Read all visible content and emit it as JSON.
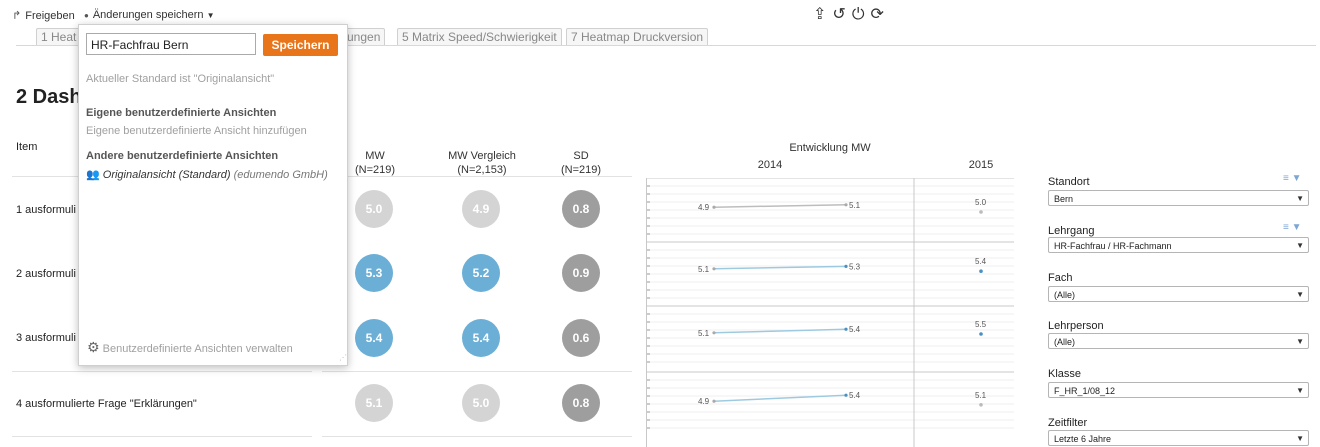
{
  "toolbar": {
    "share_label": "Freigeben",
    "save_changes_label": "Änderungen speichern",
    "icons": [
      "export-icon",
      "undo-icon",
      "power-icon",
      "refresh-icon"
    ]
  },
  "tabs": [
    {
      "label": "1 Heat"
    },
    {
      "label": "kungen"
    },
    {
      "label": "5 Matrix Speed/Schwierigkeit"
    },
    {
      "label": "7 Heatmap Druckversion"
    }
  ],
  "page_title": "2 Dash",
  "table": {
    "item_header": "Item",
    "columns": [
      {
        "title": "MW",
        "sub": "(N=219)"
      },
      {
        "title": "MW Vergleich",
        "sub": "(N=2,153)"
      },
      {
        "title": "SD",
        "sub": "(N=219)"
      }
    ],
    "rows": [
      {
        "label": "1 ausformuli",
        "mw": "5.0",
        "mw_cmp": "4.9",
        "sd": "0.8"
      },
      {
        "label": "2 ausformuli",
        "mw": "5.3",
        "mw_cmp": "5.2",
        "sd": "0.9"
      },
      {
        "label": "3 ausformuli",
        "mw": "5.4",
        "mw_cmp": "5.4",
        "sd": "0.6"
      },
      {
        "label": "4 ausformulierte Frage \"Erklärungen\"",
        "mw": "5.1",
        "mw_cmp": "5.0",
        "sd": "0.8"
      }
    ]
  },
  "chart_data": {
    "type": "line",
    "title": "Entwicklung MW",
    "years": [
      "2014",
      "2015"
    ],
    "rows": [
      {
        "y2014": [
          4.9,
          5.1
        ],
        "y2015": 5.0
      },
      {
        "y2014": [
          5.1,
          5.3
        ],
        "y2015": 5.4
      },
      {
        "y2014": [
          5.1,
          5.4
        ],
        "y2015": 5.5
      },
      {
        "y2014": [
          4.9,
          5.4
        ],
        "y2015": 5.1
      }
    ]
  },
  "filters": [
    {
      "label": "Standort",
      "value": "Bern",
      "icons": true
    },
    {
      "label": "Lehrgang",
      "value": "HR-Fachfrau / HR-Fachmann",
      "icons": true
    },
    {
      "label": "Fach",
      "value": "(Alle)",
      "icons": false
    },
    {
      "label": "Lehrperson",
      "value": "(Alle)",
      "icons": false
    },
    {
      "label": "Klasse",
      "value": "F_HR_1/08_12",
      "icons": false
    },
    {
      "label": "Zeitfilter",
      "value": "Letzte 6 Jahre",
      "icons": false
    }
  ],
  "popup": {
    "input_value": "HR-Fachfrau Bern",
    "save_button": "Speichern",
    "current_default": "Aktueller Standard ist \"Originalansicht\"",
    "own_views_heading": "Eigene benutzerdefinierte Ansichten",
    "add_own_view": "Eigene benutzerdefinierte Ansicht hinzufügen",
    "other_views_heading": "Andere benutzerdefinierte Ansichten",
    "original_view": "Originalansicht (Standard)",
    "original_view_owner": "(edumendo GmbH)",
    "manage_views": "Benutzerdefinierte Ansichten verwalten"
  },
  "colors": {
    "accent": "#e8751a",
    "blue": "#6baed6",
    "grey": "#d4d4d4",
    "dark_grey": "#9e9e9e"
  }
}
